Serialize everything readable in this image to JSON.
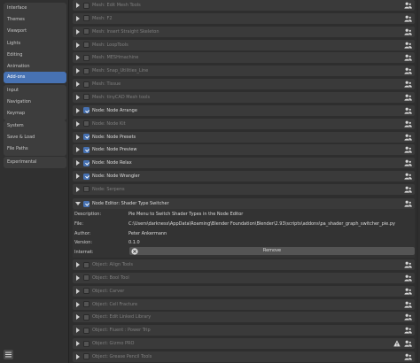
{
  "sidebar": {
    "groups": [
      {
        "items": [
          {
            "label": "Interface"
          },
          {
            "label": "Themes"
          },
          {
            "label": "Viewport"
          },
          {
            "label": "Lights"
          },
          {
            "label": "Editing"
          },
          {
            "label": "Animation"
          }
        ]
      },
      {
        "items": [
          {
            "label": "Add-ons",
            "active": true
          }
        ]
      },
      {
        "items": [
          {
            "label": "Input"
          },
          {
            "label": "Navigation"
          },
          {
            "label": "Keymap"
          }
        ]
      },
      {
        "items": [
          {
            "label": "System"
          },
          {
            "label": "Save & Load"
          },
          {
            "label": "File Paths"
          }
        ]
      },
      {
        "items": [
          {
            "label": "Experimental"
          }
        ]
      }
    ]
  },
  "addons_before": [
    {
      "label": "Mesh: Edit Mesh Tools",
      "enabled": false
    },
    {
      "label": "Mesh: F2",
      "enabled": false
    },
    {
      "label": "Mesh: Insert Straight Skeleton",
      "enabled": false
    },
    {
      "label": "Mesh: LoopTools",
      "enabled": false
    },
    {
      "label": "Mesh: MESHmachine",
      "enabled": false
    },
    {
      "label": "Mesh: Snap_Utilities_Line",
      "enabled": false
    },
    {
      "label": "Mesh: Tissue",
      "enabled": false
    },
    {
      "label": "Mesh: tinyCAD Mesh tools",
      "enabled": false
    },
    {
      "label": "Node: Node Arrange",
      "enabled": true
    },
    {
      "label": "Node: Node Kit",
      "enabled": false
    },
    {
      "label": "Node: Node Presets",
      "enabled": true
    },
    {
      "label": "Node: Node Preview",
      "enabled": true
    },
    {
      "label": "Node: Node Relax",
      "enabled": true
    },
    {
      "label": "Node: Node Wrangler",
      "enabled": true
    },
    {
      "label": "Node: Serpens",
      "enabled": false
    }
  ],
  "expanded": {
    "label": "Node Editor: Shader Type Switcher",
    "enabled": true,
    "description_label": "Description:",
    "description": "Pie Menu to Switch Shader Types in the Node Editor",
    "file_label": "File:",
    "file": "C:\\Users\\darkness\\AppData\\Roaming\\Blender Foundation\\Blender\\2.93\\scripts\\addons\\pa_shader_graph_switcher_pie.py",
    "author_label": "Author:",
    "author": "Peter Ankermann",
    "version_label": "Version:",
    "version": "0.1.0",
    "internet_label": "Internet:",
    "remove_label": "Remove"
  },
  "addons_after": [
    {
      "label": "Object: Align Tools",
      "enabled": false
    },
    {
      "label": "Object: Bool Tool",
      "enabled": false
    },
    {
      "label": "Object: Carver",
      "enabled": false
    },
    {
      "label": "Object: Cell Fracture",
      "enabled": false
    },
    {
      "label": "Object: Edit Linked Library",
      "enabled": false
    },
    {
      "label": "Object: Fluent : Power Trip",
      "enabled": false
    },
    {
      "label": "Object: Gizmo PRO",
      "enabled": false,
      "warning": true
    },
    {
      "label": "Object: Grease Pencil Tools",
      "enabled": false
    }
  ],
  "colors": {
    "accent": "#4772b3",
    "warning": "#e0e0e0"
  }
}
